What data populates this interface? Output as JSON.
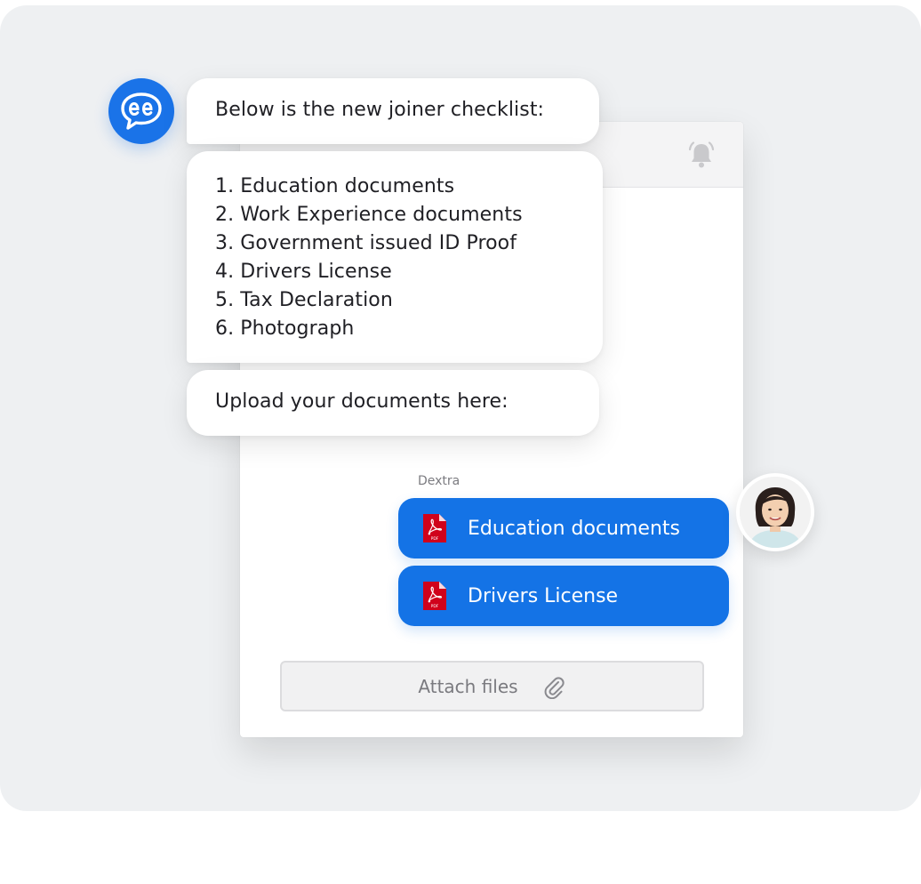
{
  "messages": {
    "intro": "Below is the new joiner checklist:",
    "checklist": [
      "1. Education documents",
      "2. Work Experience documents",
      "3. Government issued ID Proof",
      "4. Drivers License",
      "5. Tax Declaration",
      "6. Photograph"
    ],
    "upload_prompt": "Upload your documents here:"
  },
  "reply": {
    "sender": "Dextra",
    "files": [
      {
        "name": "Education documents",
        "icon": "pdf-icon"
      },
      {
        "name": "Drivers License",
        "icon": "pdf-icon"
      }
    ]
  },
  "attach": {
    "label": "Attach files",
    "icon": "paperclip-icon"
  },
  "icons": {
    "bot": "chatbot-logo-icon",
    "bell": "bell-icon",
    "user": "user-avatar"
  },
  "colors": {
    "accent": "#1473e6",
    "bot_blue": "#1a73e8",
    "pdf_red": "#d0021b",
    "background": "#eef0f2"
  }
}
